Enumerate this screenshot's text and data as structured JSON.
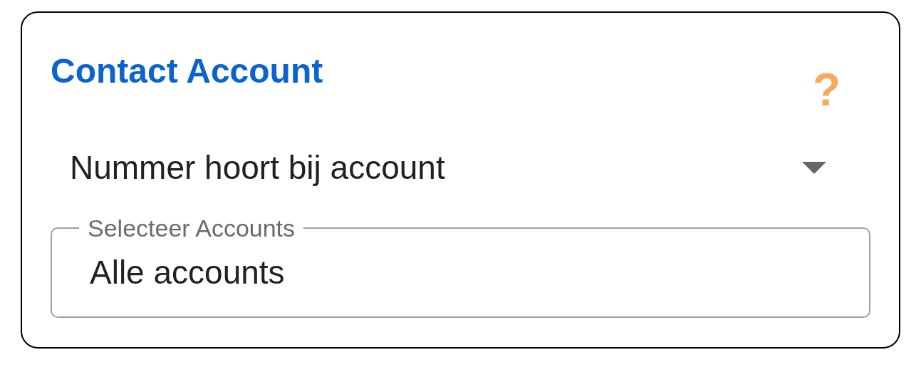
{
  "title": "Contact Account",
  "help": "?",
  "dropdown": {
    "value": "Nummer hoort bij account"
  },
  "accounts_field": {
    "label": "Selecteer Accounts",
    "value": "Alle accounts"
  }
}
